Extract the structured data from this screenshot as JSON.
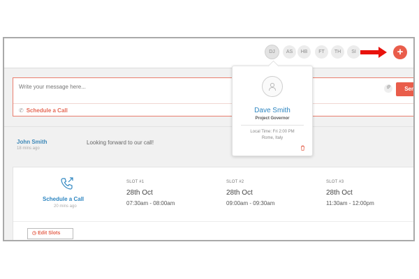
{
  "header": {
    "avatars": [
      {
        "initials": "DJ",
        "active": true
      },
      {
        "initials": "AS",
        "active": false
      },
      {
        "initials": "HB",
        "active": false
      },
      {
        "initials": "FT",
        "active": false
      },
      {
        "initials": "TH",
        "active": false
      },
      {
        "initials": "SI",
        "active": false
      }
    ],
    "add_icon": "plus-icon",
    "arrow_color": "#e8120c"
  },
  "composer": {
    "placeholder": "Write your message here...",
    "attach_icon": "paperclip-icon",
    "send_label": "Send",
    "schedule_label": "Schedule a Call"
  },
  "message": {
    "sender": "John Smith",
    "time": "18 mins ago",
    "text": "Looking forward to our call!"
  },
  "call_card": {
    "title": "Schedule a Call",
    "time": "20 mins ago",
    "slots": [
      {
        "label": "SLOT #1",
        "date": "28th Oct",
        "time": "07:30am - 08:00am"
      },
      {
        "label": "SLOT #2",
        "date": "28th Oct",
        "time": "09:00am - 09:30am"
      },
      {
        "label": "SLOT #3",
        "date": "28th Oct",
        "time": "11:30am - 12:00pm"
      }
    ],
    "edit_label": "Edit Slots"
  },
  "profile_popover": {
    "name": "Dave Smith",
    "role": "Project Governor",
    "local_time": "Local Time: Fri 2:00 PM",
    "location": "Rome, Italy",
    "delete_icon": "trash-icon"
  },
  "colors": {
    "accent": "#e95d4b",
    "link_blue": "#2e86c1"
  }
}
